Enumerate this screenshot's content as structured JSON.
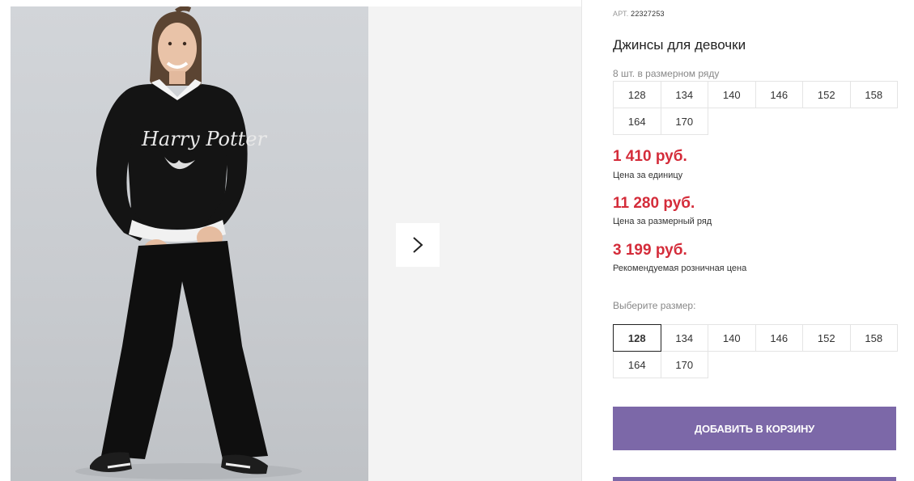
{
  "gallery": {
    "photo_alt": "",
    "sweatshirt_print": "Harry Potter",
    "next_icon": "chevron-right-icon"
  },
  "product": {
    "sku_label": "АРТ.",
    "sku_value": "22327253",
    "title": "Джинсы для девочки",
    "sizes_count": "8 шт. в размерном ряду",
    "size_range": [
      "128",
      "134",
      "140",
      "146",
      "152",
      "158",
      "164",
      "170"
    ],
    "unit_price": "1 410 руб.",
    "unit_price_label": "Цена за единицу",
    "range_price": "11 280 руб.",
    "range_price_label": "Цена за размерный ряд",
    "retail_price": "3 199 руб.",
    "retail_price_label": "Рекомендуемая розничная цена",
    "choose_size_label": "Выберите размер:",
    "size_options": [
      "128",
      "134",
      "140",
      "146",
      "152",
      "158",
      "164",
      "170"
    ],
    "selected_size": "128",
    "add_to_cart": "Добавить в корзину"
  },
  "colors": {
    "price": "#d42c3a",
    "button": "#7c68a8"
  }
}
